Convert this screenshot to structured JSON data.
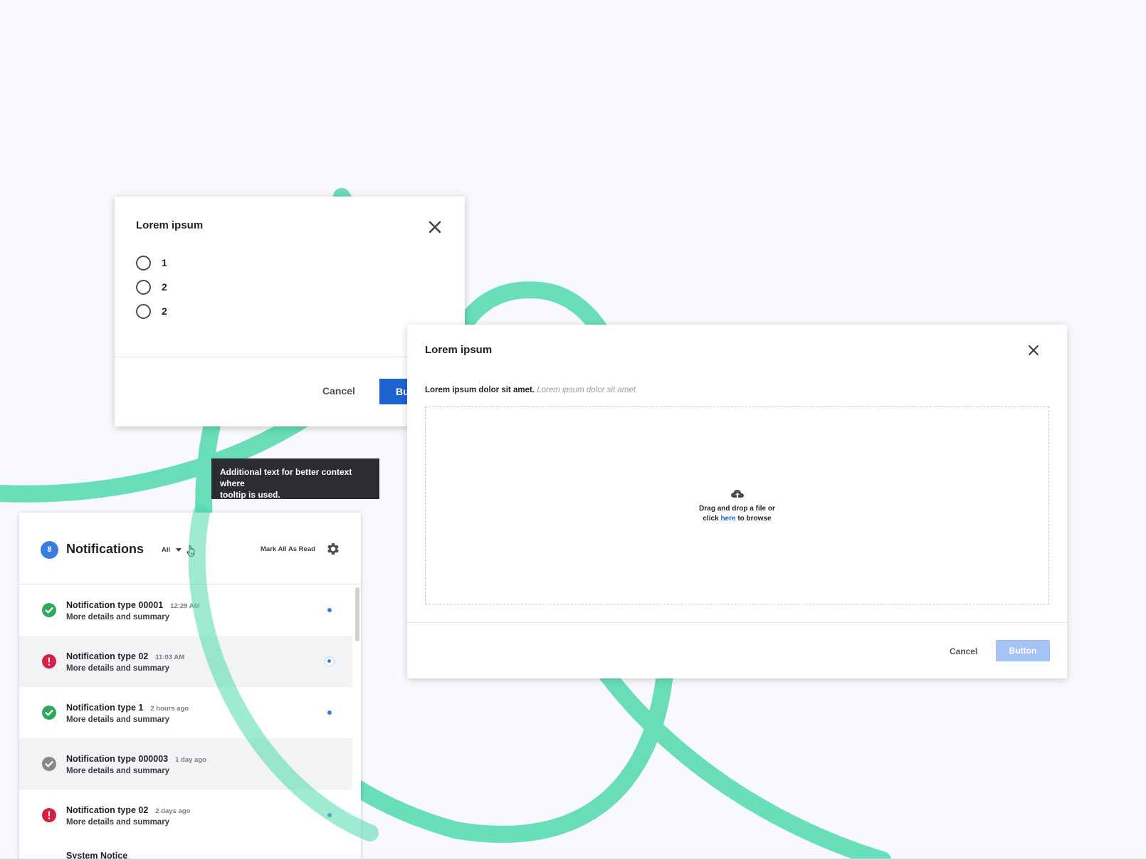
{
  "colors": {
    "background": "#f8f9fc",
    "swirl": "#4fd9ad",
    "primary": "#1e63d2",
    "primary_disabled": "#a4c2f2",
    "badge": "#3a7de0",
    "success": "#2eaa5c",
    "error": "#d52145",
    "neutral": "#888888",
    "tooltip_bg": "#2b2d31"
  },
  "radio_dialog": {
    "title": "Lorem ipsum",
    "close_icon": "close-icon",
    "options": [
      {
        "label": "1"
      },
      {
        "label": "2"
      },
      {
        "label": "2"
      }
    ],
    "cancel_label": "Cancel",
    "primary_label": "Bu"
  },
  "tooltip": {
    "text": "Additional text for better context\nwhere\ntooltip is used."
  },
  "upload_dialog": {
    "title": "Lorem ipsum",
    "close_icon": "close-icon",
    "description_bold": "Lorem ipsum dolor sit amet.",
    "description_hint": "Lorem ipsum dolor sit amet",
    "upload_icon": "cloud-upload-icon",
    "drop_text_line1": "Drag and drop a file or",
    "drop_text_click": "click",
    "drop_text_link": "here",
    "drop_text_end": "to browse",
    "cancel_label": "Cancel",
    "primary_label": "Button"
  },
  "notifications": {
    "count": "8",
    "title": "Notifications",
    "filter": "All",
    "mark_all_label": "Mark All As Read",
    "settings_icon": "gear-icon",
    "items": [
      {
        "title": "Notification type 00001",
        "time": "12:29 AM",
        "details": "More details and summary",
        "status": "success"
      },
      {
        "title": "Notification type 02",
        "time": "11:03 AM",
        "details": "More details and summary",
        "status": "error"
      },
      {
        "title": "Notification type 1",
        "time": "2 hours ago",
        "details": "More details and summary",
        "status": "success"
      },
      {
        "title": "Notification type 000003",
        "time": "1 day ago",
        "details": "More details and summary",
        "status": "read"
      },
      {
        "title": "Notification type 02",
        "time": "2 days ago",
        "details": "More details and summary",
        "status": "error"
      }
    ],
    "partial_item_title": "System Notice"
  }
}
